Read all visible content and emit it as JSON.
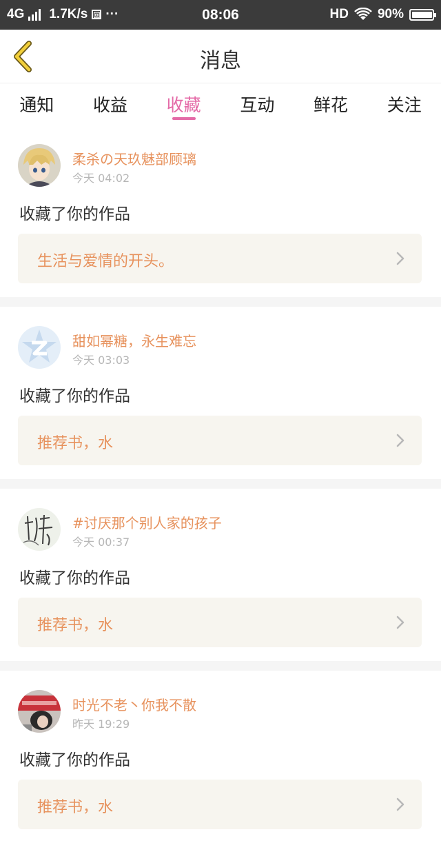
{
  "status_bar": {
    "network": "4G",
    "speed": "1.7K/s",
    "box_glyph": "回",
    "dots": "···",
    "time": "08:06",
    "hd": "HD",
    "battery": "90%"
  },
  "header": {
    "title": "消息",
    "back_icon": "chevron-left-icon"
  },
  "tabs": [
    {
      "label": "通知",
      "active": false
    },
    {
      "label": "收益",
      "active": false
    },
    {
      "label": "收藏",
      "active": true
    },
    {
      "label": "互动",
      "active": false
    },
    {
      "label": "鲜花",
      "active": false
    },
    {
      "label": "关注",
      "active": false
    }
  ],
  "colors": {
    "accent_pink": "#e46aa7",
    "name_orange": "#e7925d",
    "card_bg": "#f7f5ef",
    "statusbar_bg": "#3b3b3b"
  },
  "messages": [
    {
      "user": "柔杀の天玖魅部顾璃",
      "time": "今天 04:02",
      "action": "收藏了你的作品",
      "work": "生活与爱情的开头。",
      "avatar": "anime-avatar"
    },
    {
      "user": "甜如幂糖，永生难忘",
      "time": "今天 03:03",
      "action": "收藏了你的作品",
      "work": "推荐书，水",
      "avatar": "default-z-avatar"
    },
    {
      "user": "#讨厌那个别人家的孩子",
      "time": "今天 00:37",
      "action": "收藏了你的作品",
      "work": "推荐书，水",
      "avatar": "calligraphy-avatar"
    },
    {
      "user": "时光不老丶你我不散",
      "time": "昨天 19:29",
      "action": "收藏了你的作品",
      "work": "推荐书，水",
      "avatar": "photo-avatar"
    }
  ]
}
